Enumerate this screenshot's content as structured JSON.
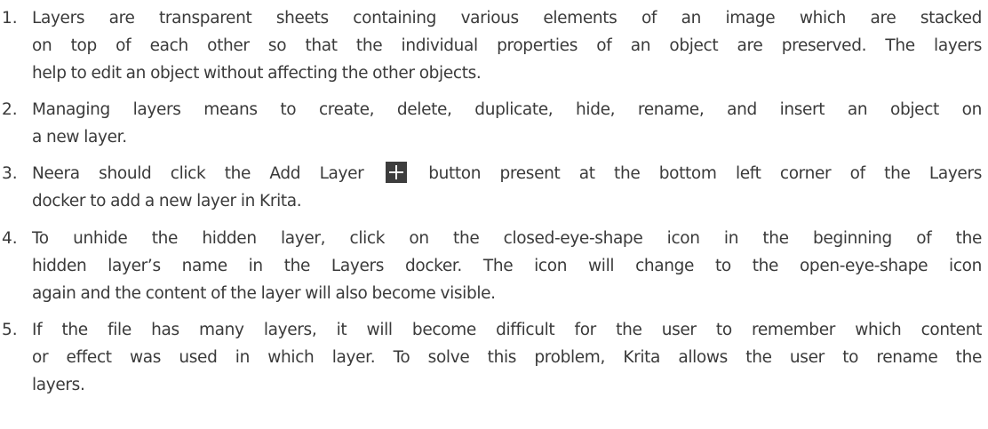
{
  "answers": [
    {
      "number": "1.",
      "lines": [
        "Layers are transparent sheets containing various elements of an image which are stacked",
        "on top of each other so that the individual properties of an object are preserved. The layers",
        "help to edit an object without affecting the other objects."
      ]
    },
    {
      "number": "2.",
      "lines": [
        "Managing layers means to create, delete, duplicate, hide, rename, and insert an object on",
        "a new layer."
      ]
    },
    {
      "number": "3.",
      "line1_before_icon": "Neera should click the Add Layer",
      "line1_after_icon": "button present at the bottom left corner of the Layers",
      "line2": "docker to add a new layer in Krita.",
      "icon": "add-layer-plus-icon"
    },
    {
      "number": "4.",
      "lines": [
        "To unhide the hidden layer, click on the closed-eye-shape icon in the beginning of the",
        "hidden layer’s name in the Layers docker. The icon will change to the open-eye-shape icon",
        "again and the content of the layer will also become visible."
      ]
    },
    {
      "number": "5.",
      "lines": [
        "If the file has many layers, it will become difficult for the user to remember which content",
        "or effect was used in which layer. To solve this problem, Krita allows the user to rename the",
        "layers."
      ]
    }
  ],
  "colors": {
    "text": "#3a3a3a",
    "icon_background": "#3d3d3d",
    "icon_glyph": "#ffffff"
  }
}
